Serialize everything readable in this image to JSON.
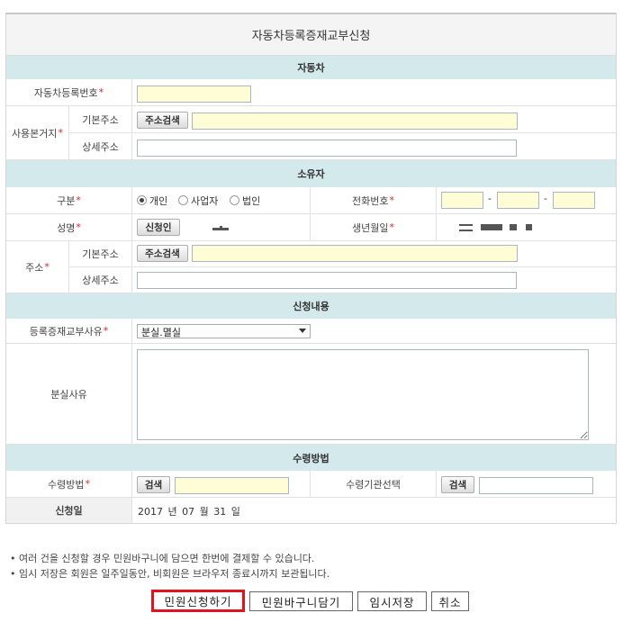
{
  "title": "자동차등록증재교부신청",
  "sections": {
    "vehicle": "자동차",
    "owner": "소유자",
    "application": "신청내용",
    "receipt": "수령방법"
  },
  "vehicle": {
    "reg_no_label": "자동차등록번호",
    "reg_no_value": "",
    "location_label": "사용본거지",
    "basic_addr_label": "기본주소",
    "detail_addr_label": "상세주소",
    "addr_search_button": "주소검색"
  },
  "owner": {
    "type_label": "구분",
    "type_options": [
      "개인",
      "사업자",
      "법인"
    ],
    "type_selected": "개인",
    "phone_label": "전화번호",
    "phone_sep": "-",
    "name_label": "성명",
    "applicant_button": "신청인",
    "birth_label": "생년월일",
    "addr_label": "주소",
    "basic_addr_label": "기본주소",
    "detail_addr_label": "상세주소",
    "addr_search_button": "주소검색"
  },
  "application": {
    "reason_label": "등록증재교부사유",
    "reason_selected": "분실.멸실",
    "loss_reason_label": "분실사유",
    "loss_reason_value": ""
  },
  "receipt": {
    "method_label": "수령방법",
    "search_button": "검색",
    "agency_label": "수령기관선택",
    "agency_search_button": "검색",
    "date_label": "신청일",
    "date_value": "2017 년 07 월 31 일"
  },
  "notes": [
    "• 여러 건을 신청할 경우 민원바구니에 담으면 한번에 결제할 수 있습니다.",
    "• 임시 저장은 회원은 일주일동안, 비회원은 브라우저 종료시까지 보관됩니다."
  ],
  "required_mark": "*",
  "buttons": {
    "apply": "민원신청하기",
    "basket": "민원바구니담기",
    "temp_save": "임시저장",
    "cancel": "취소"
  },
  "colors": {
    "section_bg": "#d3e9ec",
    "required": "#d6252c",
    "input_highlight": "#fffdd5",
    "apply_border": "#e0141e"
  }
}
